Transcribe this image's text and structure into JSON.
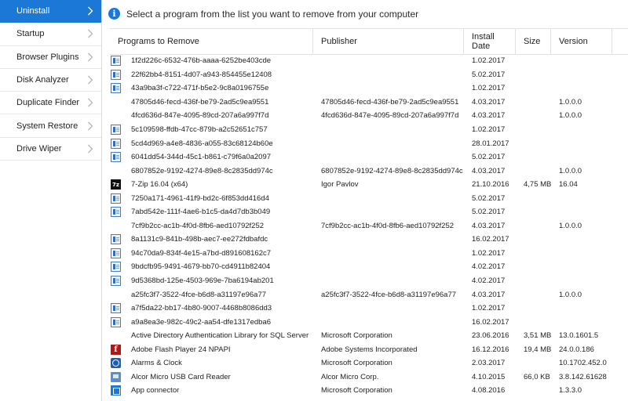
{
  "sidebar": {
    "items": [
      {
        "label": "Uninstall",
        "name": "sidebar-item-uninstall",
        "active": true
      },
      {
        "label": "Startup",
        "name": "sidebar-item-startup"
      },
      {
        "label": "Browser Plugins",
        "name": "sidebar-item-browser-plugins"
      },
      {
        "label": "Disk Analyzer",
        "name": "sidebar-item-disk-analyzer"
      },
      {
        "label": "Duplicate Finder",
        "name": "sidebar-item-duplicate-finder"
      },
      {
        "label": "System Restore",
        "name": "sidebar-item-system-restore"
      },
      {
        "label": "Drive Wiper",
        "name": "sidebar-item-drive-wiper"
      }
    ]
  },
  "info": {
    "icon": "info-icon",
    "text": "Select a program from the list you want to remove from your computer"
  },
  "table": {
    "columns": {
      "name": "Programs to Remove",
      "publisher": "Publisher",
      "date": "Install Date",
      "size": "Size",
      "version": "Version"
    },
    "rows": [
      {
        "icon": "generic",
        "name": "1f2d226c-6532-476b-aaaa-6252be403cde",
        "publisher": "",
        "date": "1.02.2017",
        "size": "",
        "version": ""
      },
      {
        "icon": "generic",
        "name": "22f62bb4-8151-4d07-a943-854455e12408",
        "publisher": "",
        "date": "5.02.2017",
        "size": "",
        "version": ""
      },
      {
        "icon": "generic",
        "name": "43a9ba3f-c722-471f-b5e2-9c8a0196755e",
        "publisher": "",
        "date": "1.02.2017",
        "size": "",
        "version": ""
      },
      {
        "icon": "none",
        "name": "47805d46-fecd-436f-be79-2ad5c9ea9551",
        "publisher": "47805d46-fecd-436f-be79-2ad5c9ea9551",
        "date": "4.03.2017",
        "size": "",
        "version": "1.0.0.0"
      },
      {
        "icon": "none",
        "name": "4fcd636d-847e-4095-89cd-207a6a997f7d",
        "publisher": "4fcd636d-847e-4095-89cd-207a6a997f7d",
        "date": "4.03.2017",
        "size": "",
        "version": "1.0.0.0"
      },
      {
        "icon": "generic",
        "name": "5c109598-ffdb-47cc-879b-a2c52651c757",
        "publisher": "",
        "date": "1.02.2017",
        "size": "",
        "version": ""
      },
      {
        "icon": "generic",
        "name": "5cd4d969-a4e8-4836-a055-83c68124b60e",
        "publisher": "",
        "date": "28.01.2017",
        "size": "",
        "version": ""
      },
      {
        "icon": "generic",
        "name": "6041dd54-344d-45c1-b861-c79f6a0a2097",
        "publisher": "",
        "date": "5.02.2017",
        "size": "",
        "version": ""
      },
      {
        "icon": "none",
        "name": "6807852e-9192-4274-89e8-8c2835dd974c",
        "publisher": "6807852e-9192-4274-89e8-8c2835dd974c",
        "date": "4.03.2017",
        "size": "",
        "version": "1.0.0.0"
      },
      {
        "icon": "7zip",
        "name": "7-Zip 16.04 (x64)",
        "publisher": "Igor Pavlov",
        "date": "21.10.2016",
        "size": "4,75 MB",
        "version": "16.04"
      },
      {
        "icon": "generic",
        "name": "7250a171-4961-41f9-bd2c-6f853dd416d4",
        "publisher": "",
        "date": "5.02.2017",
        "size": "",
        "version": ""
      },
      {
        "icon": "generic",
        "name": "7abd542e-111f-4ae6-b1c5-da4d7db3b049",
        "publisher": "",
        "date": "5.02.2017",
        "size": "",
        "version": ""
      },
      {
        "icon": "none",
        "name": "7cf9b2cc-ac1b-4f0d-8fb6-aed10792f252",
        "publisher": "7cf9b2cc-ac1b-4f0d-8fb6-aed10792f252",
        "date": "4.03.2017",
        "size": "",
        "version": "1.0.0.0"
      },
      {
        "icon": "generic",
        "name": "8a1131c9-841b-498b-aec7-ee272fdbafdc",
        "publisher": "",
        "date": "16.02.2017",
        "size": "",
        "version": ""
      },
      {
        "icon": "generic",
        "name": "94c70da9-834f-4e15-a7bd-d891608162c7",
        "publisher": "",
        "date": "1.02.2017",
        "size": "",
        "version": ""
      },
      {
        "icon": "generic",
        "name": "9bdcfb95-9491-4679-bb70-cd4911b82404",
        "publisher": "",
        "date": "4.02.2017",
        "size": "",
        "version": ""
      },
      {
        "icon": "generic",
        "name": "9d5368bd-125e-4503-969e-7ba6194ab201",
        "publisher": "",
        "date": "4.02.2017",
        "size": "",
        "version": ""
      },
      {
        "icon": "none",
        "name": "a25fc3f7-3522-4fce-b6d8-a31197e96a77",
        "publisher": "a25fc3f7-3522-4fce-b6d8-a31197e96a77",
        "date": "4.03.2017",
        "size": "",
        "version": "1.0.0.0"
      },
      {
        "icon": "generic",
        "name": "a7f5da22-bb17-4b80-9007-4468b8086dd3",
        "publisher": "",
        "date": "1.02.2017",
        "size": "",
        "version": ""
      },
      {
        "icon": "generic",
        "name": "a9a8ea3e-982c-49c2-aa54-dfe1317edba6",
        "publisher": "",
        "date": "16.02.2017",
        "size": "",
        "version": ""
      },
      {
        "icon": "none",
        "name": "Active Directory Authentication Library for SQL Server",
        "publisher": "Microsoft Corporation",
        "date": "23.06.2016",
        "size": "3,51 MB",
        "version": "13.0.1601.5"
      },
      {
        "icon": "flash",
        "name": "Adobe Flash Player 24 NPAPI",
        "publisher": "Adobe Systems Incorporated",
        "date": "16.12.2016",
        "size": "19,4 MB",
        "version": "24.0.0.186"
      },
      {
        "icon": "clock",
        "name": "Alarms & Clock",
        "publisher": "Microsoft Corporation",
        "date": "2.03.2017",
        "size": "",
        "version": "10.1702.452.0"
      },
      {
        "icon": "usb",
        "name": "Alcor Micro USB Card Reader",
        "publisher": "Alcor Micro Corp.",
        "date": "4.10.2015",
        "size": "66,0 KB",
        "version": "3.8.142.61628"
      },
      {
        "icon": "app",
        "name": "App connector",
        "publisher": "Microsoft Corporation",
        "date": "4.08.2016",
        "size": "",
        "version": "1.3.3.0"
      }
    ]
  },
  "colors": {
    "accent": "#1c78d6"
  }
}
